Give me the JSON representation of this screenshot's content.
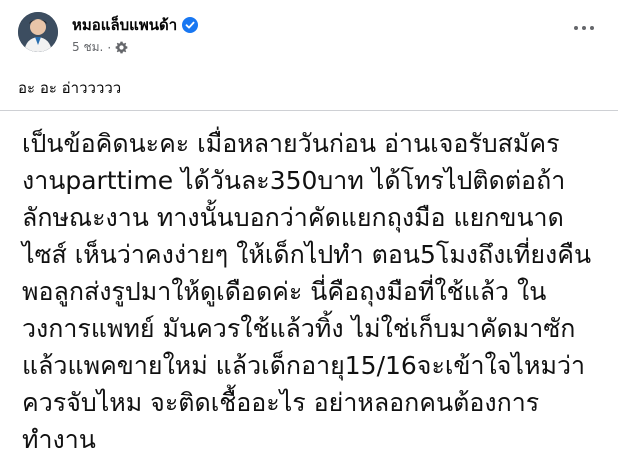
{
  "post": {
    "author": "หมอแล็บแพนด้า",
    "time": "5 ชม.",
    "separator": "·",
    "caption": "อะ อะ อ่าววววว",
    "image_text": "เป็นข้อคิดนะคะ เมื่อหลายวันก่อน อ่านเจอรับสมัคร\nงานparttime ได้วันละ350บาท ได้โทรไปติดต่อถ้า\nลักษณะงาน ทางนั้นบอกว่าคัดแยกถุงมือ แยกขนาด\nไซส์ เห็นว่าคงง่ายๆ ให้เด็กไปทำ ตอน5โมงถึงเที่ยงคืน\nพอลูกส่งรูปมาให้ดูเดือดค่ะ นี่คือถุงมือที่ใช้แล้ว ใน\nวงการแพทย์ มันควรใช้แล้วทิ้ง ไม่ใช่เก็บมาคัดมาซัก\nแล้วแพคขายใหม่ แล้วเด็กอายุ15/16จะเข้าใจไหมว่า\nควรจับไหม จะติดเชื้ออะไร อย่าหลอกคนต้องการ\nทำงาน"
  },
  "icons": {
    "verified": "verified-badge-icon",
    "privacy": "gear-icon",
    "more": "more-options-icon"
  },
  "colors": {
    "verified_blue": "#1877f2",
    "meta_gray": "#65676b"
  }
}
